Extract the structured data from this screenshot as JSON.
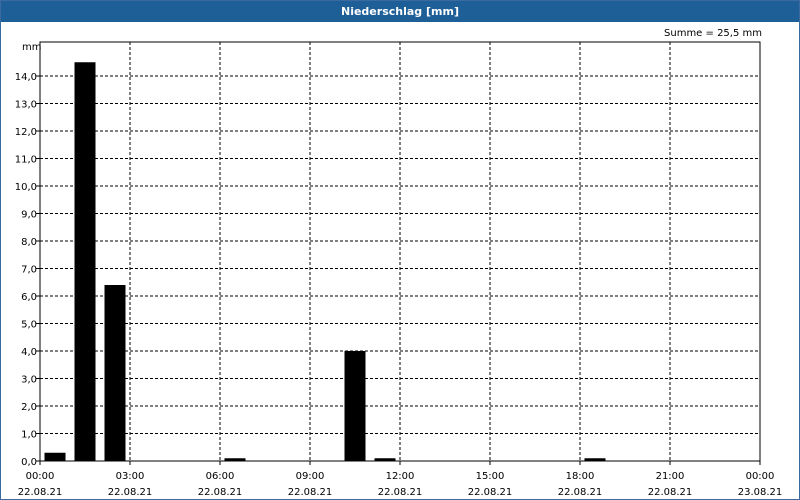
{
  "title": "Niederschlag [mm]",
  "summary": "Summe = 25,5 mm",
  "colors": {
    "title_bar": "#1f5f97",
    "title_text": "#ffffff",
    "bars": "#000000",
    "grid": "#000000"
  },
  "chart_data": {
    "type": "bar",
    "title": "Niederschlag [mm]",
    "ylabel": "mm",
    "xlabel": "",
    "ylim": [
      0,
      15
    ],
    "yticks": [
      "0,0",
      "1,0",
      "2,0",
      "3,0",
      "4,0",
      "5,0",
      "6,0",
      "7,0",
      "8,0",
      "9,0",
      "10,0",
      "11,0",
      "12,0",
      "13,0",
      "14,0"
    ],
    "xrange_hours": [
      0,
      24
    ],
    "xticks": [
      {
        "time": "00:00",
        "date": "22.08.21",
        "hour": 0
      },
      {
        "time": "03:00",
        "date": "22.08.21",
        "hour": 3
      },
      {
        "time": "06:00",
        "date": "22.08.21",
        "hour": 6
      },
      {
        "time": "09:00",
        "date": "22.08.21",
        "hour": 9
      },
      {
        "time": "12:00",
        "date": "22.08.21",
        "hour": 12
      },
      {
        "time": "15:00",
        "date": "22.08.21",
        "hour": 15
      },
      {
        "time": "18:00",
        "date": "22.08.21",
        "hour": 18
      },
      {
        "time": "21:00",
        "date": "22.08.21",
        "hour": 21
      },
      {
        "time": "00:00",
        "date": "23.08.21",
        "hour": 24
      }
    ],
    "grid": true,
    "bars": [
      {
        "hour": 0,
        "value": 0.3
      },
      {
        "hour": 1,
        "value": 14.5
      },
      {
        "hour": 2,
        "value": 6.4
      },
      {
        "hour": 6,
        "value": 0.1
      },
      {
        "hour": 10,
        "value": 4.0
      },
      {
        "hour": 11,
        "value": 0.1
      },
      {
        "hour": 18,
        "value": 0.1
      }
    ],
    "bar_interval_hours": 1
  }
}
